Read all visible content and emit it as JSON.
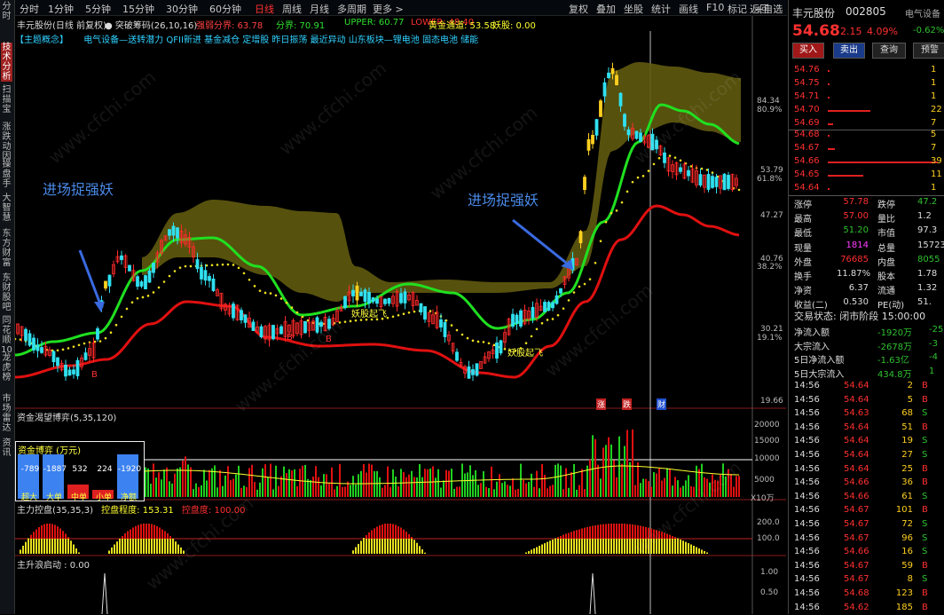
{
  "sidebar": [
    "分时",
    "技术分析",
    "扫描宝",
    "涨跌动因",
    "操盘手",
    "大智慧",
    "东方财富",
    "东财股吧",
    "同花顺10",
    "龙虎榜",
    "市场雷达",
    "资讯"
  ],
  "topbar": {
    "periods": [
      "分时",
      "1分钟",
      "5分钟",
      "15分钟",
      "30分钟",
      "60分钟",
      "日线",
      "周线",
      "月线",
      "多周期",
      "更多 >"
    ],
    "tools": [
      "复权",
      "叠加",
      "坐股",
      "统计",
      "画线",
      "F10",
      "标记",
      "+自选",
      "返回"
    ]
  },
  "title": {
    "name": "丰元股份(日线 前复权)",
    "indicator": "● 突破筹码(26,10,16)",
    "qiangruo": "强弱分界: 63.78",
    "fenjie": "分界: 70.91",
    "upper": "UPPER: 60.77",
    "lower": "LOWER: 48.40",
    "golden": "黄金通道: 53.58",
    "yaogu": "妖股: 0.00"
  },
  "concept": {
    "label": "【主题概念】",
    "text": "电气设备—送转潜力 QFII新进 基金减仓 定增股 昨日振荡 最近异动 山东板块—锂电池 固态电池 储能"
  },
  "annotations": [
    "进场捉强妖",
    "进场捉强妖"
  ],
  "chart_marks": [
    "妖股起飞",
    "妖股起飞",
    "涨",
    "跌",
    "财",
    "B",
    "B",
    "B"
  ],
  "price_axis": [
    "84.34",
    "80.9%",
    "61.8%",
    "53.79",
    "47.27",
    "40.76",
    "38.2%",
    "30.21",
    "19.1%",
    "19.66"
  ],
  "indicator1": {
    "title": "资金渴望博弈(5,35,120)",
    "box_title": "资金博弈 (万元)",
    "bars": [
      {
        "label": "超大",
        "value": "-789",
        "color": "#3c82f0"
      },
      {
        "label": "大单",
        "value": "-1887",
        "color": "#3c82f0"
      },
      {
        "label": "中单",
        "value": "532",
        "color": "#e02020"
      },
      {
        "label": "小单",
        "value": "224",
        "color": "#e02020"
      },
      {
        "label": "净额",
        "value": "-1920",
        "color": "#3c82f0"
      }
    ],
    "axis": [
      "20000",
      "15000",
      "10000",
      "10240",
      "5000",
      "X10万"
    ]
  },
  "indicator2": {
    "title": "主力控盘(35,35,3)",
    "degree": "控盘程度: 153.31",
    "control": "控盘度: 100.00",
    "axis": [
      "200.0",
      "100.0"
    ]
  },
  "indicator3": {
    "title": "主升浪启动 : 0.00",
    "axis": [
      "1.00",
      "0.50"
    ]
  },
  "quote": {
    "name": "丰元股份",
    "code": "002805",
    "industry": "电气设备",
    "price": "54.68",
    "change": "2.15",
    "pct": "4.09%",
    "ind_pct": "-0.62%",
    "buttons": [
      "买入",
      "卖出",
      "查询",
      "预警"
    ],
    "asks": [
      {
        "l": "54.76",
        "p": "54.76",
        "v": "1"
      },
      {
        "l": "54.75",
        "p": "54.75",
        "v": "1"
      },
      {
        "l": "54.71",
        "p": "54.71",
        "v": "1"
      },
      {
        "l": "54.70",
        "p": "54.70",
        "v": "22"
      },
      {
        "l": "54.69",
        "p": "54.69",
        "v": "7"
      }
    ],
    "bids": [
      {
        "p": "54.68",
        "v": "5"
      },
      {
        "p": "54.67",
        "v": "7"
      },
      {
        "p": "54.66",
        "v": "39"
      },
      {
        "p": "54.65",
        "v": "11"
      },
      {
        "p": "54.64",
        "v": "1"
      }
    ],
    "stats": [
      [
        "涨停",
        "57.78",
        "跌停",
        "47.2"
      ],
      [
        "最高",
        "57.00",
        "量比",
        "1.2"
      ],
      [
        "最低",
        "51.20",
        "市值",
        "97.3"
      ],
      [
        "现量",
        "1814",
        "总量",
        "15723"
      ],
      [
        "外盘",
        "76685",
        "内盘",
        "8055"
      ],
      [
        "换手",
        "11.87%",
        "股本",
        "1.78"
      ],
      [
        "净资",
        "6.37",
        "流通",
        "1.32"
      ],
      [
        "收益(二)",
        "0.530",
        "PE(动)",
        "51."
      ]
    ],
    "status": "交易状态: 闭市阶段 15:00:00",
    "flows": [
      [
        "净流入额",
        "-1920万",
        "-25"
      ],
      [
        "大宗流入",
        "-2678万",
        "-3"
      ],
      [
        "5日净流入额",
        "-1.63亿",
        "-4"
      ],
      [
        "5日大宗流入",
        "434.8万",
        "1"
      ]
    ],
    "ticks": [
      [
        "14:56",
        "54.64",
        "2",
        "B"
      ],
      [
        "14:56",
        "54.64",
        "5",
        "B"
      ],
      [
        "14:56",
        "54.63",
        "68",
        "S"
      ],
      [
        "14:56",
        "54.64",
        "51",
        "B"
      ],
      [
        "14:56",
        "54.64",
        "19",
        "S"
      ],
      [
        "14:56",
        "54.64",
        "27",
        "S"
      ],
      [
        "14:56",
        "54.64",
        "25",
        "B"
      ],
      [
        "14:56",
        "54.66",
        "36",
        "B"
      ],
      [
        "14:56",
        "54.66",
        "61",
        "S"
      ],
      [
        "14:56",
        "54.67",
        "101",
        "B"
      ],
      [
        "14:56",
        "54.67",
        "72",
        "S"
      ],
      [
        "14:56",
        "54.67",
        "96",
        "S"
      ],
      [
        "14:56",
        "54.66",
        "16",
        "S"
      ],
      [
        "14:56",
        "54.67",
        "59",
        "B"
      ],
      [
        "14:56",
        "54.67",
        "8",
        "S"
      ],
      [
        "14:56",
        "54.68",
        "123",
        "B"
      ],
      [
        "14:56",
        "54.62",
        "185",
        "B"
      ]
    ]
  }
}
